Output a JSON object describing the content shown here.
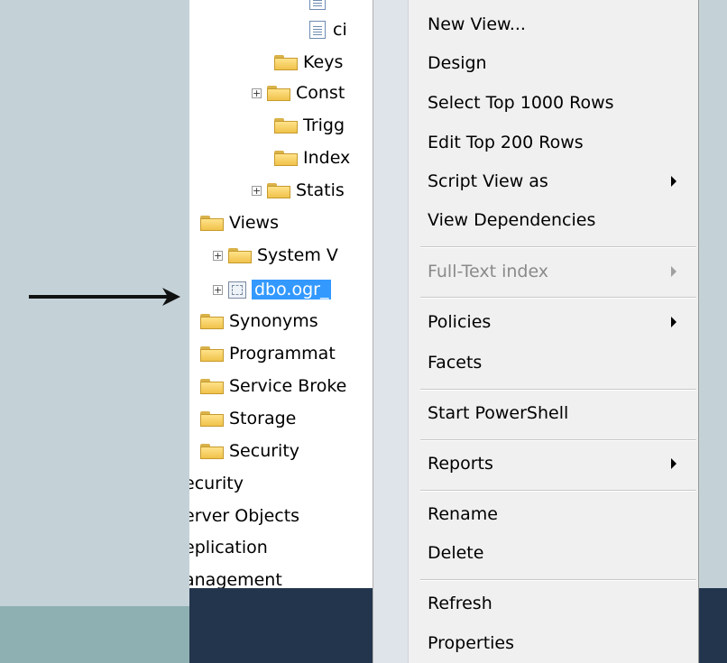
{
  "tree": {
    "items": [
      {
        "label": "ci",
        "icon": "document-icon"
      },
      {
        "label": "Keys",
        "icon": "folder-icon"
      },
      {
        "label": "Const",
        "icon": "folder-icon",
        "expander": "+"
      },
      {
        "label": "Trigg",
        "icon": "folder-icon"
      },
      {
        "label": "Index",
        "icon": "folder-icon"
      },
      {
        "label": "Statis",
        "icon": "folder-icon",
        "expander": "+"
      },
      {
        "label": "Views",
        "icon": "folder-icon"
      },
      {
        "label": "System V",
        "icon": "folder-icon",
        "expander": "+"
      },
      {
        "label": "dbo.ogr_",
        "icon": "view-icon",
        "expander": "+",
        "selected": true
      },
      {
        "label": "Synonyms",
        "icon": "folder-icon"
      },
      {
        "label": "Programmat",
        "icon": "folder-icon"
      },
      {
        "label": "Service Broke",
        "icon": "folder-icon"
      },
      {
        "label": "Storage",
        "icon": "folder-icon"
      },
      {
        "label": "Security",
        "icon": "folder-icon"
      },
      {
        "label": "ecurity"
      },
      {
        "label": "erver Objects"
      },
      {
        "label": "eplication"
      },
      {
        "label": "anagement"
      }
    ]
  },
  "context_menu": {
    "items": [
      {
        "label": "New View..."
      },
      {
        "label": "Design"
      },
      {
        "label": "Select Top 1000 Rows"
      },
      {
        "label": "Edit Top 200 Rows"
      },
      {
        "label": "Script View as",
        "submenu": true
      },
      {
        "label": "View Dependencies"
      },
      {
        "label": "Full-Text index",
        "submenu": true,
        "disabled": true
      },
      {
        "label": "Policies",
        "submenu": true
      },
      {
        "label": "Facets"
      },
      {
        "label": "Start PowerShell"
      },
      {
        "label": "Reports",
        "submenu": true
      },
      {
        "label": "Rename"
      },
      {
        "label": "Delete"
      },
      {
        "label": "Refresh"
      },
      {
        "label": "Properties"
      }
    ]
  },
  "colors": {
    "background": "#c4d2d8",
    "selection": "#3399ff",
    "menu_background": "#f0f0f0",
    "taskbar": "#23354d"
  }
}
